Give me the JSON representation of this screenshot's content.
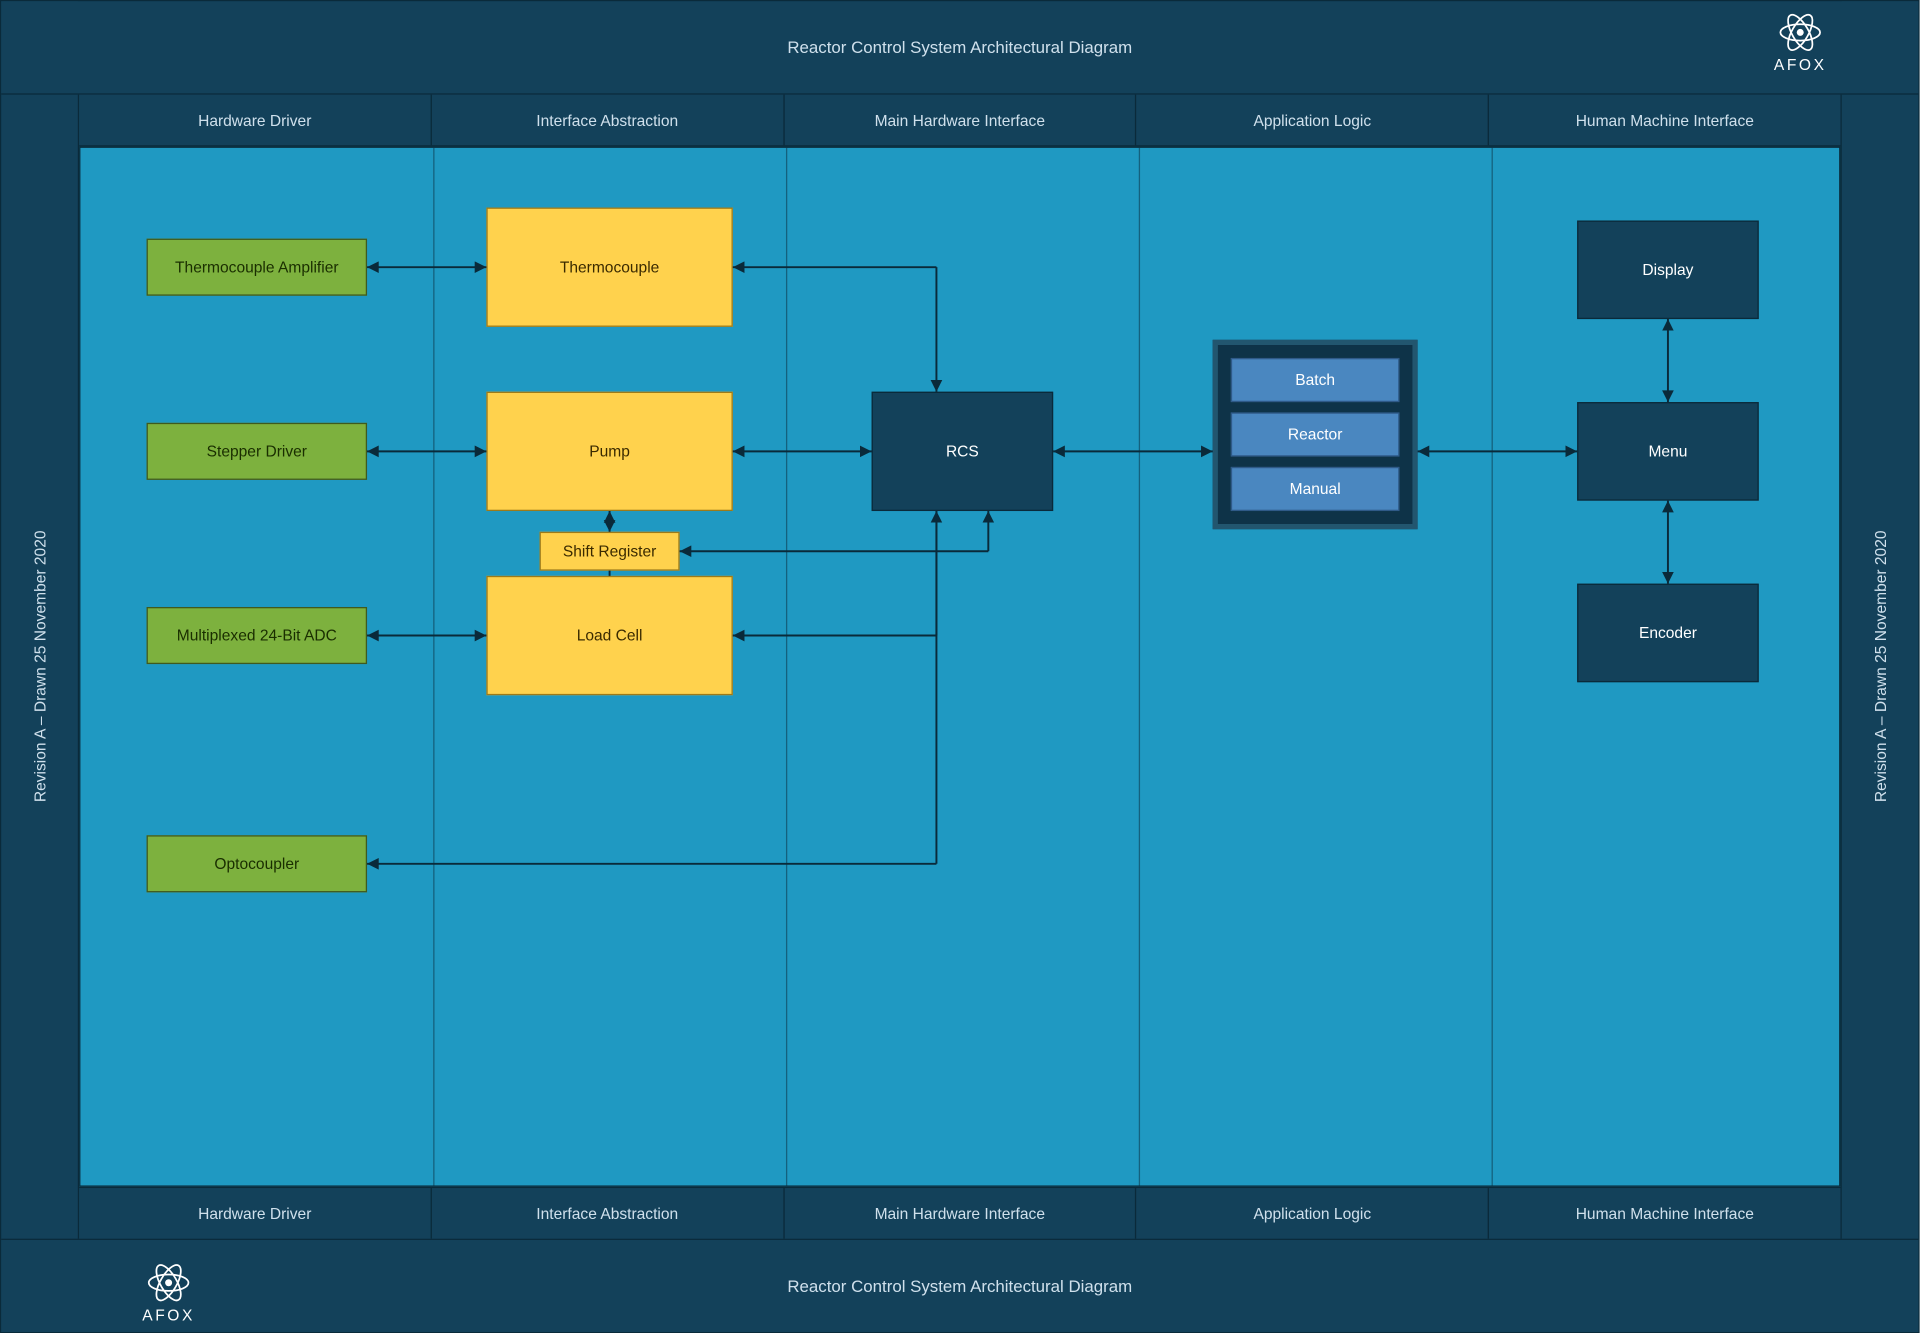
{
  "title": "Reactor Control System Architectural Diagram",
  "revision": "Revision A – Drawn 25 November 2020",
  "brand": "AFOX",
  "columns": [
    "Hardware Driver",
    "Interface Abstraction",
    "Main Hardware Interface",
    "Application Logic",
    "Human Machine Interface"
  ],
  "hw_driver": {
    "thermo_amp": "Thermocouple Amplifier",
    "stepper": "Stepper Driver",
    "adc": "Multiplexed 24-Bit ADC",
    "opto": "Optocoupler"
  },
  "iface": {
    "thermocouple": "Thermocouple",
    "pump": "Pump",
    "shift_register": "Shift Register",
    "load_cell": "Load Cell"
  },
  "main": {
    "rcs": "RCS"
  },
  "app": {
    "batch": "Batch",
    "reactor": "Reactor",
    "manual": "Manual"
  },
  "hmi": {
    "display": "Display",
    "menu": "Menu",
    "encoder": "Encoder"
  }
}
